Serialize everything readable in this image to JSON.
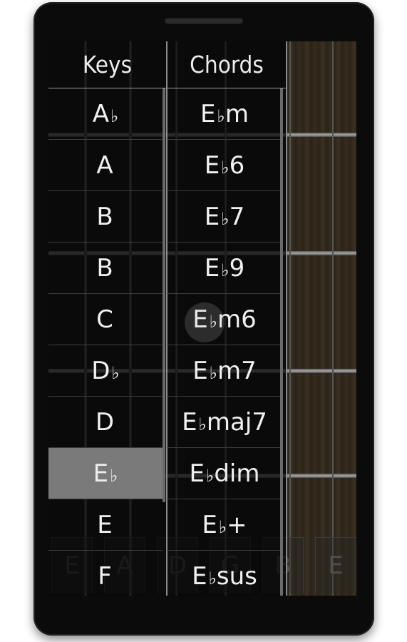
{
  "device": {
    "type": "android-phone"
  },
  "fretboard": {
    "open_strings": [
      "E",
      "A",
      "D",
      "G",
      "B",
      "E"
    ]
  },
  "columns": {
    "keys_header": "Keys",
    "chords_header": "Chords"
  },
  "keys": [
    {
      "root": "A",
      "flat": "♭"
    },
    {
      "root": "A",
      "flat": ""
    },
    {
      "root": "B",
      "flat": ""
    },
    {
      "root": "B",
      "flat": ""
    },
    {
      "root": "C",
      "flat": ""
    },
    {
      "root": "D",
      "flat": "♭"
    },
    {
      "root": "D",
      "flat": ""
    },
    {
      "root": "E",
      "flat": "♭"
    },
    {
      "root": "E",
      "flat": ""
    },
    {
      "root": "F",
      "flat": ""
    }
  ],
  "selected_key_index": 7,
  "chords": [
    {
      "root": "E",
      "flat": "♭",
      "quality": "m"
    },
    {
      "root": "E",
      "flat": "♭",
      "quality": "6"
    },
    {
      "root": "E",
      "flat": "♭",
      "quality": "7"
    },
    {
      "root": "E",
      "flat": "♭",
      "quality": "9"
    },
    {
      "root": "E",
      "flat": "♭",
      "quality": "m6"
    },
    {
      "root": "E",
      "flat": "♭",
      "quality": "m7"
    },
    {
      "root": "E",
      "flat": "♭",
      "quality": "maj7"
    },
    {
      "root": "E",
      "flat": "♭",
      "quality": "dim"
    },
    {
      "root": "E",
      "flat": "♭",
      "quality": "+"
    },
    {
      "root": "E",
      "flat": "♭",
      "quality": "sus"
    }
  ],
  "colors": {
    "selected_row": "#7a7a7a",
    "text": "#f0f0f0",
    "wood": "#2b2418"
  }
}
